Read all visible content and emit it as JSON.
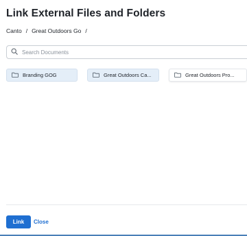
{
  "dialog": {
    "title": "Link External Files and Folders"
  },
  "breadcrumb": {
    "items": [
      "Canto",
      "Great Outdoors Go"
    ],
    "separator": "/"
  },
  "search": {
    "placeholder": "Search Documents",
    "value": ""
  },
  "folders": [
    {
      "label": "Branding GOG",
      "selected": true
    },
    {
      "label": "Great Outdoors Ca...",
      "selected": true
    },
    {
      "label": "Great Outdoors Pro...",
      "selected": false
    }
  ],
  "footer": {
    "link_label": "Link",
    "close_label": "Close"
  },
  "colors": {
    "accent": "#1f6fd1",
    "selected_folder_bg": "#e4eef8"
  }
}
